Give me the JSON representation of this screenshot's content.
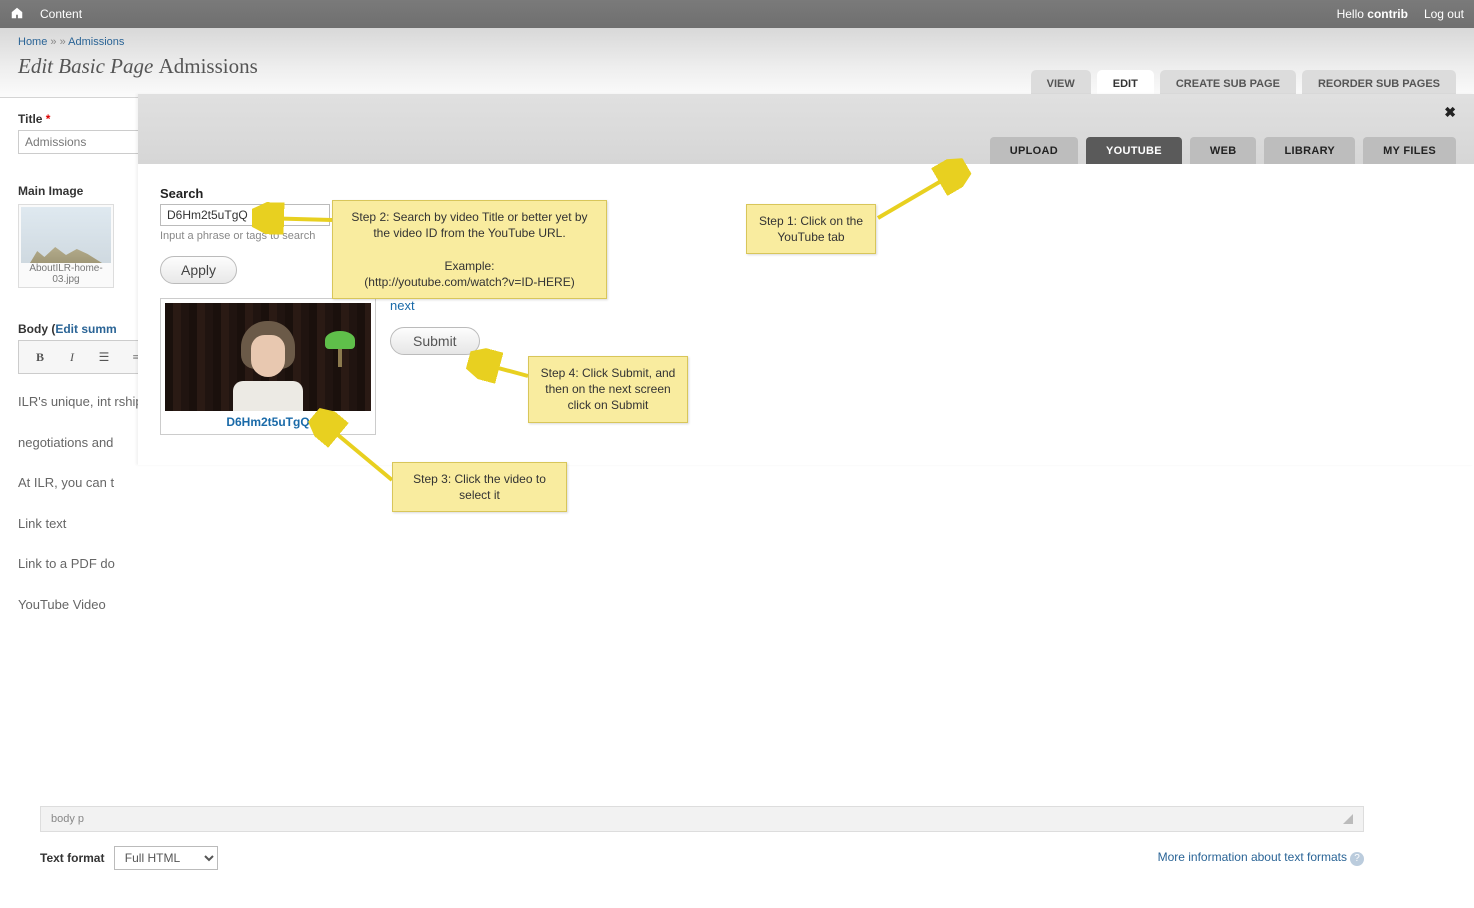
{
  "topbar": {
    "content_link": "Content",
    "hello": "Hello ",
    "username": "contrib",
    "logout": "Log out"
  },
  "breadcrumb": {
    "home": "Home",
    "sep": " » » ",
    "current": "Admissions"
  },
  "page_title": {
    "prefix": "Edit Basic Page ",
    "name": "Admissions"
  },
  "page_tabs": {
    "view": "VIEW",
    "edit": "EDIT",
    "create": "CREATE SUB PAGE",
    "reorder": "REORDER SUB PAGES"
  },
  "form": {
    "title_label": "Title ",
    "title_value": "Admissions",
    "main_image_label": "Main Image",
    "thumb_caption": "AboutILR-home-03.jpg",
    "body_label_prefix": "Body (",
    "body_label_link": "Edit summ",
    "body_lines": [
      "ILR's unique, int                                                                                                                                                                                                                                      rship,",
      "negotiations and",
      "At ILR, you can t",
      "Link text",
      "Link to a PDF do",
      "YouTube Video"
    ]
  },
  "editor_status": {
    "path": "body  p"
  },
  "format": {
    "label": "Text format",
    "value": "Full HTML",
    "more": "More information about text formats"
  },
  "modal": {
    "tabs": {
      "upload": "UPLOAD",
      "youtube": "YOUTUBE",
      "web": "WEB",
      "library": "LIBRARY",
      "myfiles": "MY FILES"
    },
    "search_label": "Search",
    "search_value": "D6Hm2t5uTgQ",
    "search_hint": "Input a phrase or tags to search",
    "apply": "Apply",
    "video_id": "D6Hm2t5uTgQ",
    "next": "next",
    "submit": "Submit"
  },
  "callouts": {
    "c1": "Step 1: Click on the YouTube tab",
    "c2_l1": "Step 2: Search by video Title or better yet by the video ID from the YouTube URL.",
    "c2_l2": "Example:",
    "c2_l3": "(http://youtube.com/watch?v=ID-HERE)",
    "c3": "Step 3: Click the video to select it",
    "c4": "Step 4: Click Submit, and then on the next screen click on Submit"
  }
}
